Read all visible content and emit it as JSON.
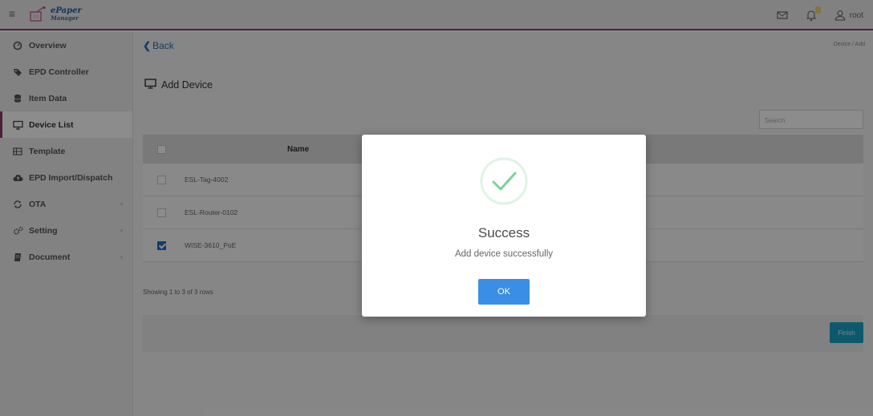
{
  "header": {
    "logo_line1": "ePaper",
    "logo_line2": "Manager",
    "user_label": "root",
    "icons": [
      "menu-icon",
      "email-icon",
      "bell-icon",
      "user-icon"
    ]
  },
  "sidebar": {
    "items": [
      {
        "label": "Overview",
        "icon": "dashboard-icon"
      },
      {
        "label": "EPD Controller",
        "icon": "tag-icon"
      },
      {
        "label": "Item Data",
        "icon": "database-icon"
      },
      {
        "label": "Device List",
        "icon": "monitor-icon",
        "active": true
      },
      {
        "label": "Template",
        "icon": "grid-icon"
      },
      {
        "label": "EPD Import/Dispatch",
        "icon": "cloud-upload-icon"
      },
      {
        "label": "OTA",
        "icon": "sync-icon",
        "has_submenu": true
      },
      {
        "label": "Setting",
        "icon": "gears-icon",
        "has_submenu": true
      },
      {
        "label": "Document",
        "icon": "book-icon",
        "has_submenu": true
      }
    ],
    "chevron": "‹"
  },
  "main": {
    "back_label": "Back",
    "breadcrumb": "Device / Add",
    "page_title": "Add Device",
    "search_placeholder": "Search",
    "table": {
      "columns": [
        "Name"
      ],
      "rows": [
        {
          "name": "ESL-Tag-4002",
          "checked": false
        },
        {
          "name": "ESL-Router-0102",
          "checked": false
        },
        {
          "name": "WISE-3610_PoE",
          "checked": true
        }
      ]
    },
    "showing_text": "Showing 1 to 3 of 3 rows",
    "finish_label": "Finish"
  },
  "modal": {
    "title": "Success",
    "message": "Add device successfully",
    "ok_label": "OK",
    "icon": "success-check-icon"
  },
  "colors": {
    "accent": "#8a3a6a",
    "link": "#2a6fb5",
    "primary_button": "#3a8ee6",
    "finish_button": "#17a2c8",
    "success_check": "#7ad39a"
  }
}
